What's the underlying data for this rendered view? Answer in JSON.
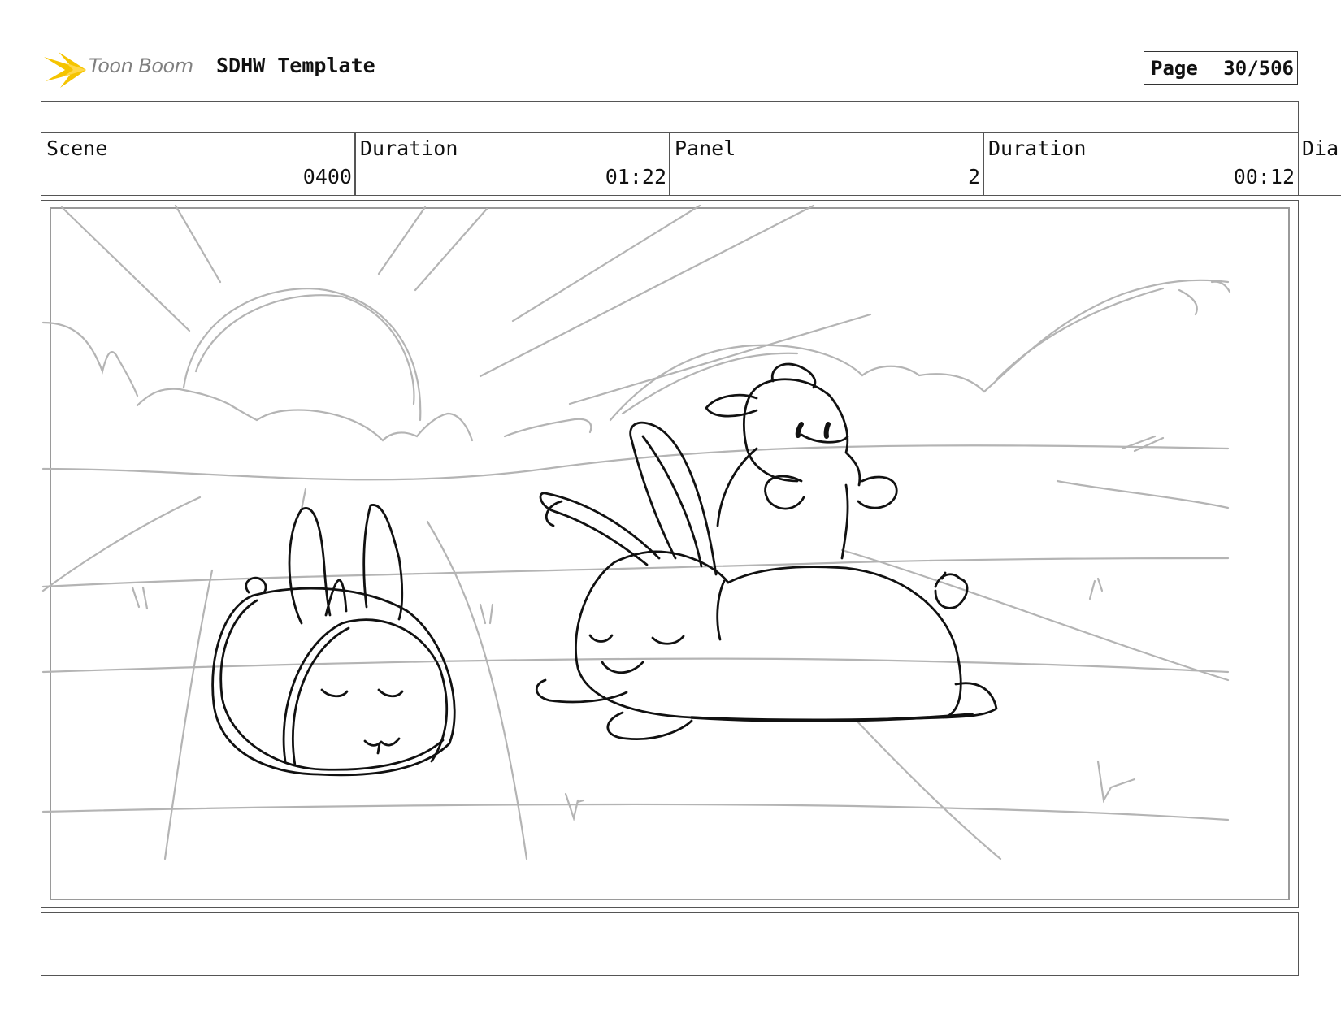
{
  "header": {
    "logo_text": "Toon Boom",
    "project_title": "SDHW Template",
    "page_label": "Page",
    "page_value": "30/506"
  },
  "info": {
    "scene_label": "Scene",
    "scene_value": "0400",
    "scene_duration_label": "Duration",
    "scene_duration_value": "01:22",
    "panel_label": "Panel",
    "panel_value": "2",
    "panel_duration_label": "Duration",
    "panel_duration_value": "00:12",
    "dialog_label_partial": "Dia"
  },
  "colors": {
    "logo_star": "#f5c400",
    "logo_text": "#808080",
    "sketch_background": "#b4b4b4",
    "sketch_foreground": "#111111"
  }
}
